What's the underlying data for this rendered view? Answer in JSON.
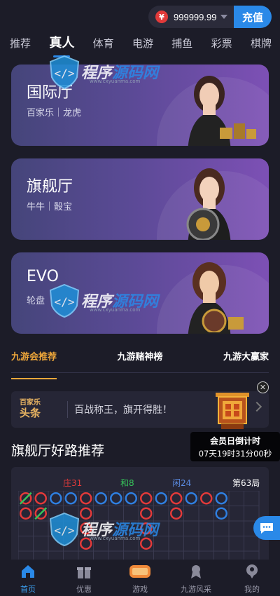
{
  "header": {
    "currency_symbol": "¥",
    "balance": "999999.99",
    "deposit_label": "充值"
  },
  "categories": [
    {
      "label": "推荐",
      "active": false
    },
    {
      "label": "真人",
      "active": true
    },
    {
      "label": "体育",
      "active": false
    },
    {
      "label": "电游",
      "active": false
    },
    {
      "label": "捕鱼",
      "active": false
    },
    {
      "label": "彩票",
      "active": false
    },
    {
      "label": "棋牌",
      "active": false
    }
  ],
  "halls": [
    {
      "title": "国际厅",
      "subtitle": "百家乐｜龙虎"
    },
    {
      "title": "旗舰厅",
      "subtitle": "牛牛｜骰宝"
    },
    {
      "title": "EVO",
      "subtitle": "轮盘"
    }
  ],
  "section_tabs": [
    {
      "label": "九游会推荐",
      "active": true
    },
    {
      "label": "九游赌神榜",
      "active": false
    },
    {
      "label": "九游大赢家",
      "active": false
    }
  ],
  "headline": {
    "logo_top": "百家乐",
    "logo_bottom": "头条",
    "text": "百战称王，旗开得胜！"
  },
  "countdown": {
    "title": "会员日倒计时",
    "time": "07天19时31分00秒"
  },
  "road": {
    "title": "旗舰厅好路推荐",
    "banker_label": "庄31",
    "tie_label": "和8",
    "player_label": "闲24",
    "round_label": "第63局",
    "colors": {
      "banker": "#e23a3a",
      "player": "#2f7fe0",
      "tie": "#36c45a"
    },
    "columns": [
      [
        "T",
        "B"
      ],
      [
        "B",
        "T"
      ],
      [
        "P"
      ],
      [
        "P"
      ],
      [
        "B",
        "B",
        "B",
        "B"
      ],
      [
        "P"
      ],
      [
        "P"
      ],
      [
        "P"
      ],
      [
        "B",
        "B",
        "B",
        "B"
      ],
      [
        "P"
      ],
      [
        "B",
        "B"
      ],
      [
        "P"
      ],
      [
        "B"
      ],
      [
        "P",
        "P"
      ]
    ]
  },
  "watermark": {
    "text_a": "程序",
    "text_b": "源码网",
    "url": "www.cxyuanma.com"
  },
  "bottom_nav": [
    {
      "label": "首页",
      "icon": "home-icon",
      "active": true
    },
    {
      "label": "优惠",
      "icon": "gift-icon",
      "active": false
    },
    {
      "label": "游戏",
      "icon": "slot-machine-icon",
      "active": false
    },
    {
      "label": "九游风采",
      "icon": "medal-icon",
      "active": false
    },
    {
      "label": "我的",
      "icon": "profile-icon",
      "active": false
    }
  ]
}
